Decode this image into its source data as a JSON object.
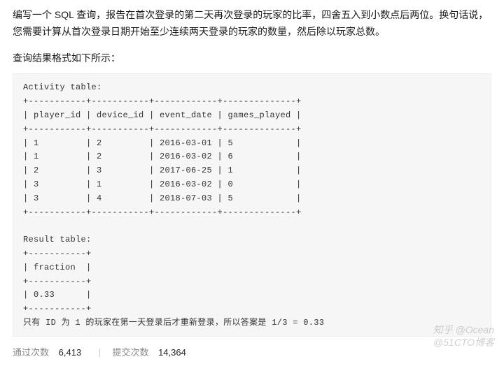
{
  "problem": {
    "description": "编写一个 SQL 查询，报告在首次登录的第二天再次登录的玩家的比率，四舍五入到小数点后两位。换句话说，您需要计算从首次登录日期开始至少连续两天登录的玩家的数量，然后除以玩家总数。",
    "result_format_label": "查询结果格式如下所示："
  },
  "code_text": "Activity table:\n+-----------+-----------+------------+--------------+\n| player_id | device_id | event_date | games_played |\n+-----------+-----------+------------+--------------+\n| 1         | 2         | 2016-03-01 | 5            |\n| 1         | 2         | 2016-03-02 | 6            |\n| 2         | 3         | 2017-06-25 | 1            |\n| 3         | 1         | 2016-03-02 | 0            |\n| 3         | 4         | 2018-07-03 | 5            |\n+-----------+-----------+------------+--------------+\n\nResult table:\n+-----------+\n| fraction  |\n+-----------+\n| 0.33      |\n+-----------+\n只有 ID 为 1 的玩家在第一天登录后才重新登录，所以答案是 1/3 = 0.33",
  "stats": {
    "pass_label": "通过次数",
    "pass_value": "6,413",
    "submit_label": "提交次数",
    "submit_value": "14,364"
  },
  "watermark": {
    "line1": "知乎 @Ocean",
    "line2": "@51CTO博客"
  }
}
